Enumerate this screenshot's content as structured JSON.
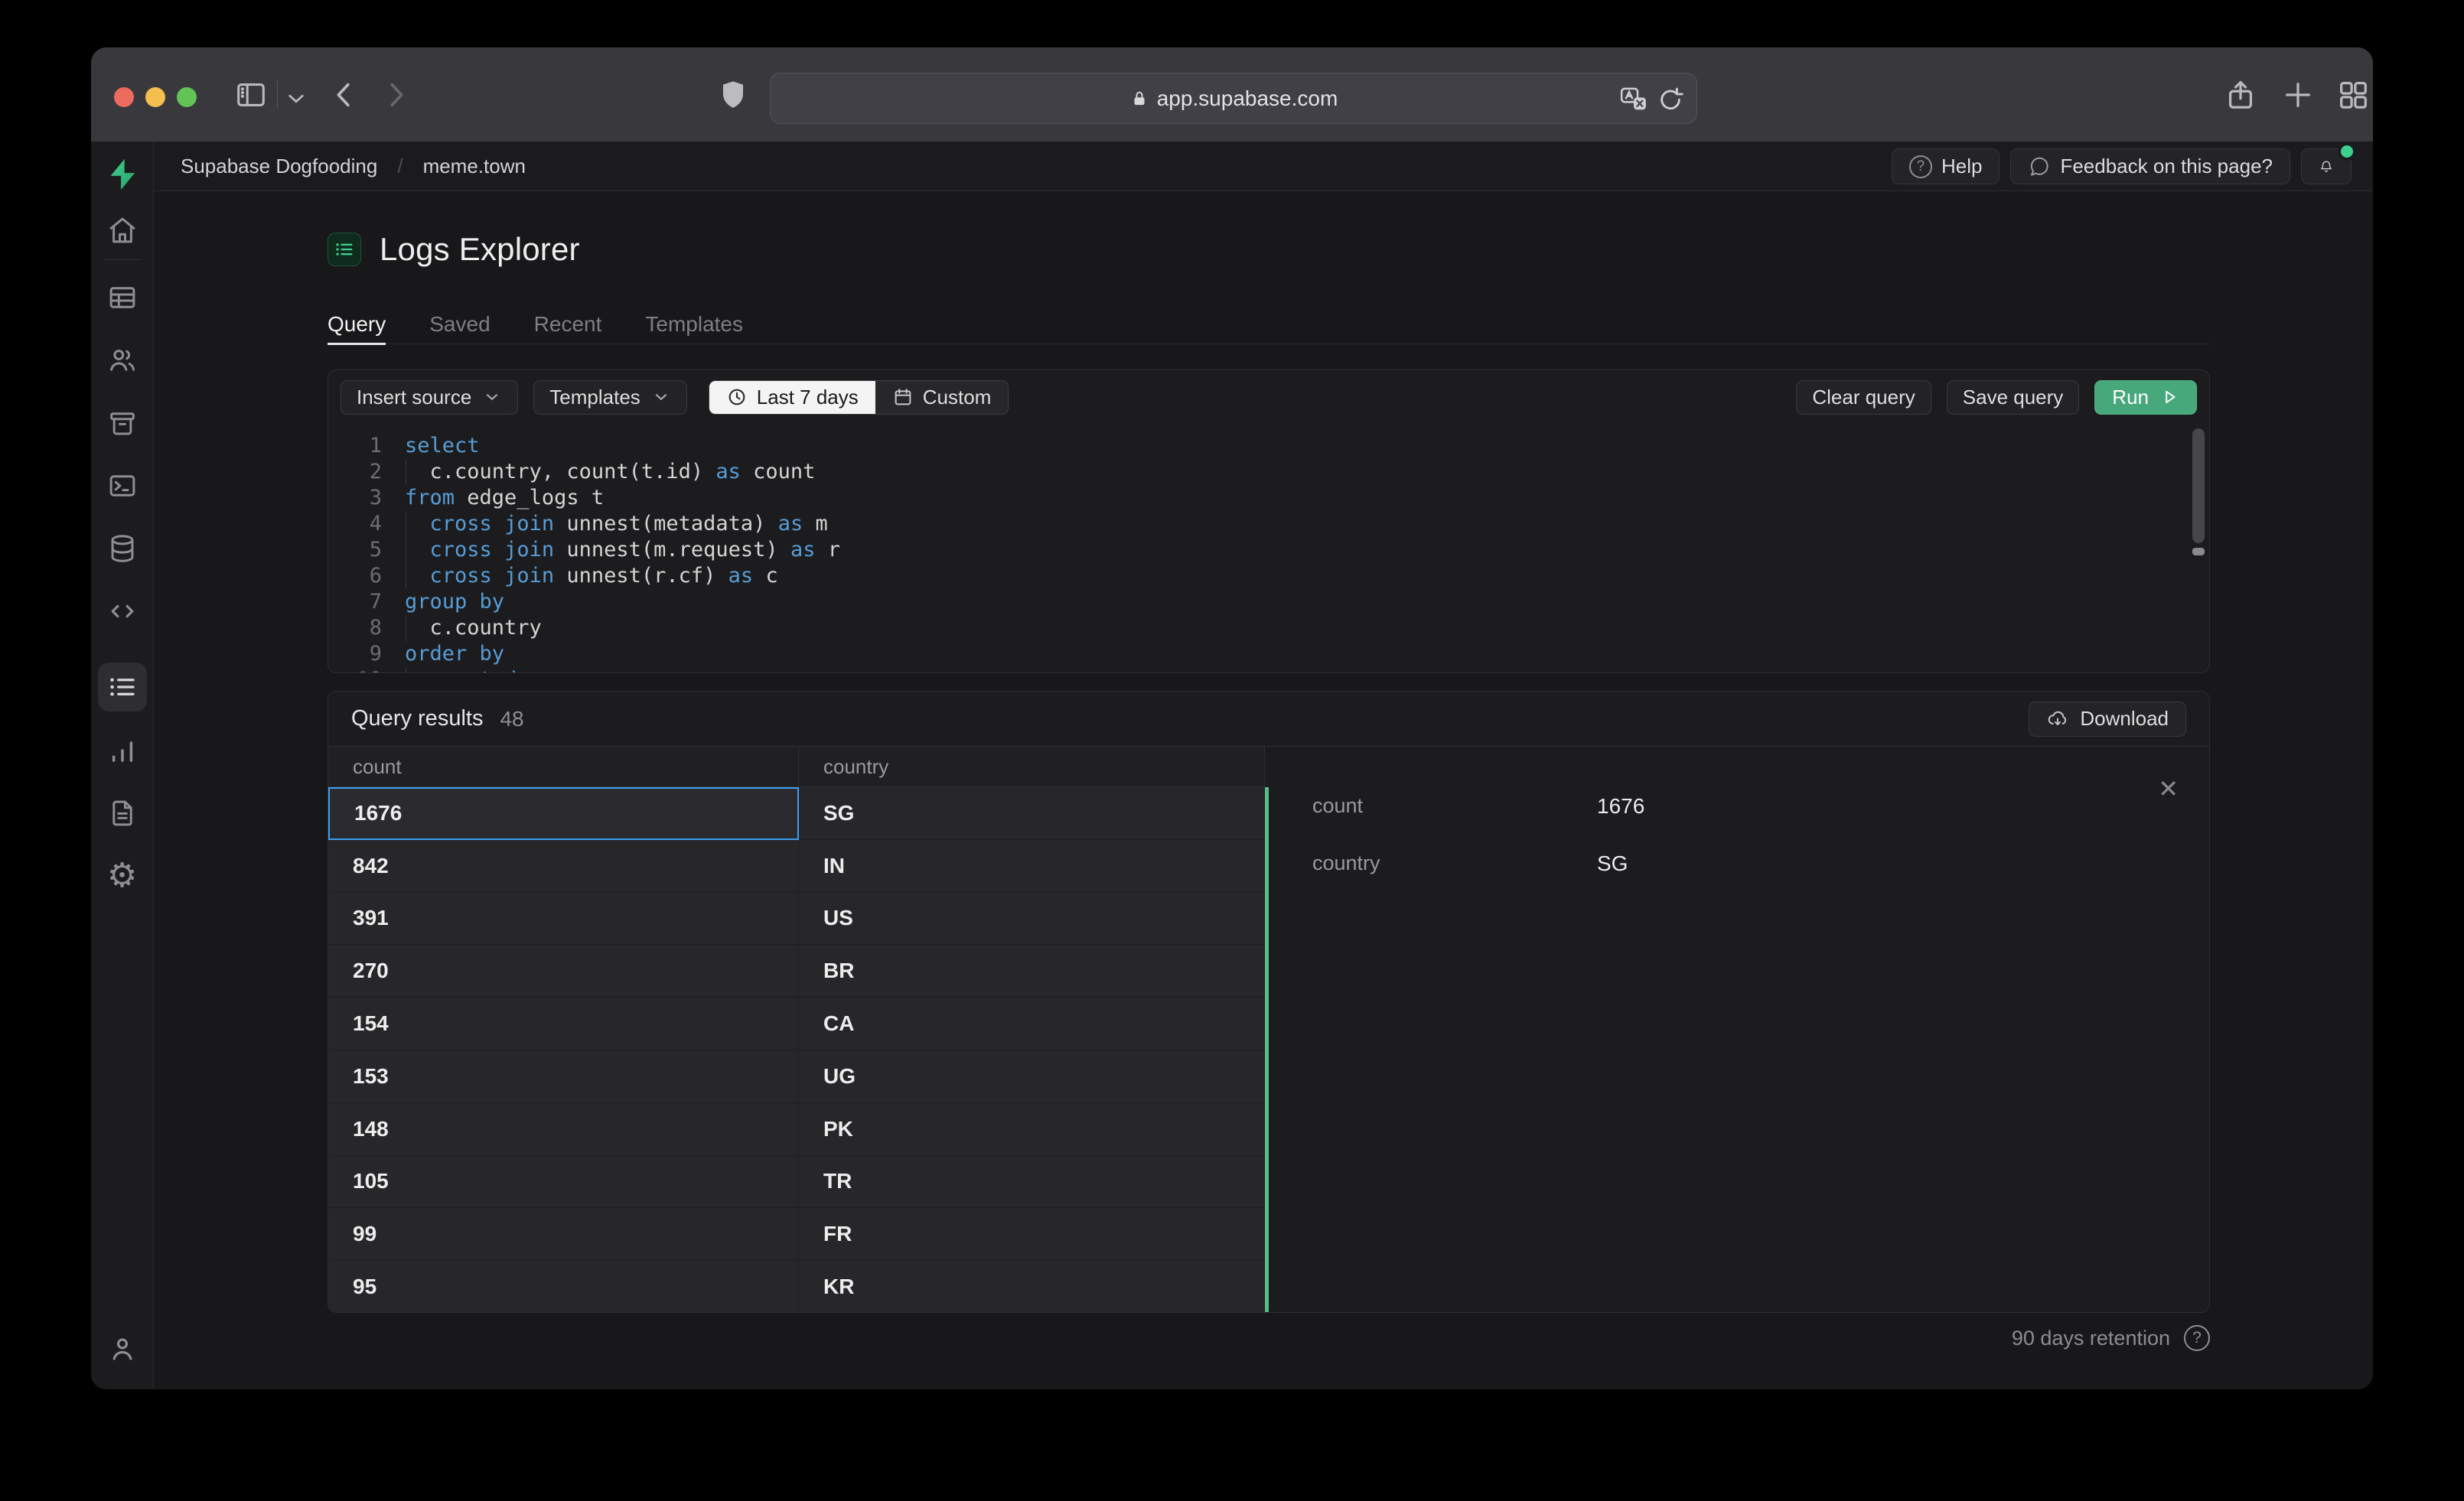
{
  "browser": {
    "url": "app.supabase.com"
  },
  "header": {
    "breadcrumb": {
      "org": "Supabase Dogfooding",
      "project": "meme.town"
    },
    "help_label": "Help",
    "feedback_label": "Feedback on this page?"
  },
  "page": {
    "title": "Logs Explorer"
  },
  "tabs": {
    "items": [
      {
        "label": "Query",
        "active": true
      },
      {
        "label": "Saved",
        "active": false
      },
      {
        "label": "Recent",
        "active": false
      },
      {
        "label": "Templates",
        "active": false
      }
    ]
  },
  "toolbar": {
    "insert_source": "Insert source",
    "templates": "Templates",
    "range_active": "Last 7 days",
    "range_custom": "Custom",
    "clear": "Clear query",
    "save": "Save query",
    "run": "Run"
  },
  "editor": {
    "lines": [
      {
        "g": 0,
        "t": [
          [
            "k",
            "select"
          ]
        ]
      },
      {
        "g": 1,
        "t": [
          [
            "p",
            "  c.country, count(t.id) "
          ],
          [
            "k",
            "as"
          ],
          [
            "p",
            " count"
          ]
        ]
      },
      {
        "g": 0,
        "t": [
          [
            "k",
            "from"
          ],
          [
            "p",
            " edge_logs t"
          ]
        ]
      },
      {
        "g": 1,
        "t": [
          [
            "p",
            "  "
          ],
          [
            "k",
            "cross"
          ],
          [
            "p",
            " "
          ],
          [
            "k",
            "join"
          ],
          [
            "p",
            " unnest(metadata) "
          ],
          [
            "k",
            "as"
          ],
          [
            "p",
            " m"
          ]
        ]
      },
      {
        "g": 1,
        "t": [
          [
            "p",
            "  "
          ],
          [
            "k",
            "cross"
          ],
          [
            "p",
            " "
          ],
          [
            "k",
            "join"
          ],
          [
            "p",
            " unnest(m.request) "
          ],
          [
            "k",
            "as"
          ],
          [
            "p",
            " r"
          ]
        ]
      },
      {
        "g": 1,
        "t": [
          [
            "p",
            "  "
          ],
          [
            "k",
            "cross"
          ],
          [
            "p",
            " "
          ],
          [
            "k",
            "join"
          ],
          [
            "p",
            " unnest(r.cf) "
          ],
          [
            "k",
            "as"
          ],
          [
            "p",
            " c"
          ]
        ]
      },
      {
        "g": 0,
        "t": [
          [
            "k",
            "group"
          ],
          [
            "p",
            " "
          ],
          [
            "k",
            "by"
          ]
        ]
      },
      {
        "g": 1,
        "t": [
          [
            "p",
            "  c.country"
          ]
        ]
      },
      {
        "g": 0,
        "t": [
          [
            "k",
            "order"
          ],
          [
            "p",
            " "
          ],
          [
            "k",
            "by"
          ]
        ]
      },
      {
        "g": 1,
        "t": [
          [
            "p",
            "  count "
          ],
          [
            "k",
            "desc"
          ]
        ]
      }
    ]
  },
  "results": {
    "title": "Query results",
    "count": "48",
    "download": "Download",
    "columns": [
      "count",
      "country"
    ],
    "rows": [
      [
        "1676",
        "SG"
      ],
      [
        "842",
        "IN"
      ],
      [
        "391",
        "US"
      ],
      [
        "270",
        "BR"
      ],
      [
        "154",
        "CA"
      ],
      [
        "153",
        "UG"
      ],
      [
        "148",
        "PK"
      ],
      [
        "105",
        "TR"
      ],
      [
        "99",
        "FR"
      ],
      [
        "95",
        "KR"
      ]
    ],
    "selected_row": 0,
    "detail": {
      "fields": [
        {
          "label": "count",
          "value": "1676"
        },
        {
          "label": "country",
          "value": "SG"
        }
      ]
    }
  },
  "footer": {
    "retention": "90 days retention"
  },
  "sidebar": {
    "items": [
      "home",
      "table-editor",
      "auth",
      "storage",
      "sql-editor",
      "database",
      "api",
      "logs",
      "reports",
      "docs",
      "settings",
      "account"
    ],
    "active": "logs"
  },
  "colors": {
    "accent_green": "#3ecf8e",
    "run_button": "#47a87c",
    "selection_blue": "#3b9ef0",
    "keyword_blue": "#569cd6"
  }
}
